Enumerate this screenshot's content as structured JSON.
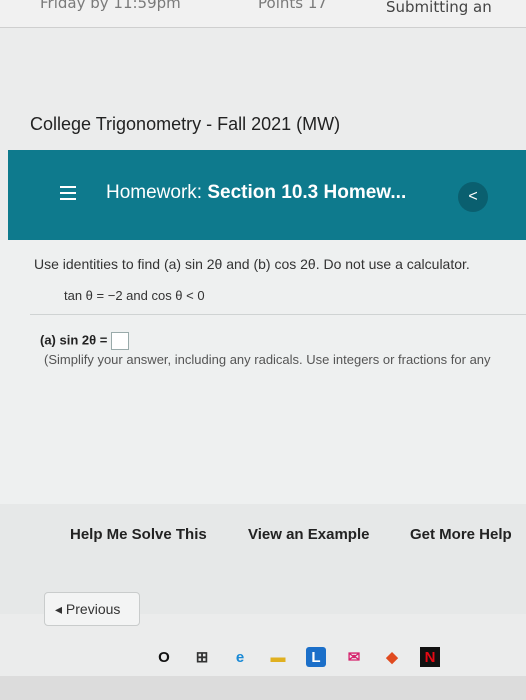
{
  "status": {
    "due": "Friday by 11:59pm",
    "points": "Points 17",
    "submitting": "Submitting an"
  },
  "course_title": "College Trigonometry - Fall 2021 (MW)",
  "banner": {
    "prefix": "Homework:",
    "title": "Section 10.3 Homew...",
    "back_symbol": "<"
  },
  "question": {
    "instruction": "Use identities to find (a) sin 2θ and (b) cos 2θ. Do not use a calculator.",
    "given": "tan θ = −2 and cos θ < 0",
    "part_a_label": "(a) sin 2θ =",
    "hint": "(Simplify your answer, including any radicals. Use integers or fractions for any"
  },
  "help": {
    "solve": "Help Me Solve This",
    "example": "View an Example",
    "more": "Get More Help"
  },
  "previous": "◂ Previous",
  "taskbar": [
    "O",
    "⊞",
    "e",
    "▬",
    "L",
    "✉",
    "◆",
    "N"
  ]
}
